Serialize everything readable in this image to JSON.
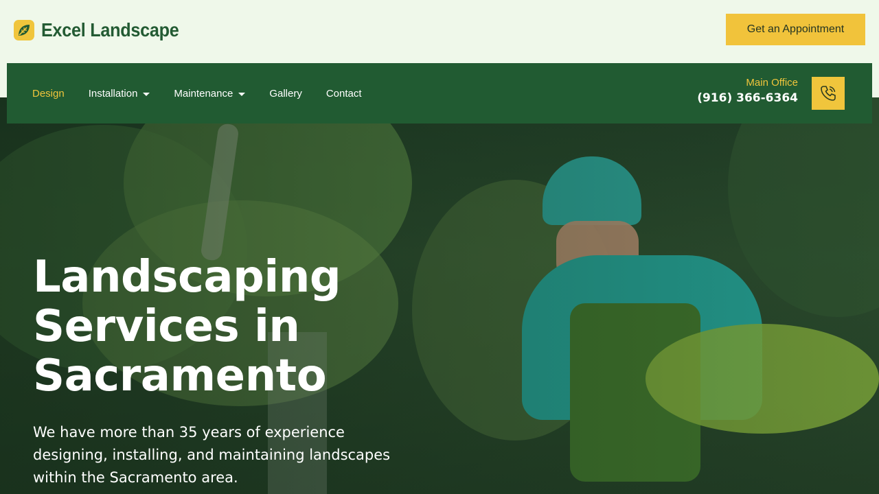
{
  "header": {
    "brand_name": "Excel Landscape",
    "logo_icon": "leaf-icon",
    "cta_label": "Get an Appointment"
  },
  "nav": {
    "items": [
      {
        "label": "Design",
        "active": true,
        "dropdown": false
      },
      {
        "label": "Installation",
        "active": false,
        "dropdown": true
      },
      {
        "label": "Maintenance",
        "active": false,
        "dropdown": true
      },
      {
        "label": "Gallery",
        "active": false,
        "dropdown": false
      },
      {
        "label": "Contact",
        "active": false,
        "dropdown": false
      }
    ],
    "office_label": "Main Office",
    "office_phone": "(916) 366-6364",
    "phone_icon": "phone-icon"
  },
  "hero": {
    "title_lines": [
      "Landscaping",
      "Services in",
      "Sacramento"
    ],
    "subtitle": "We have more than 35 years of experience designing, installing, and maintaining landscapes within the Sacramento area."
  },
  "colors": {
    "brand_green": "#215b32",
    "accent_yellow": "#f0c53c",
    "header_bg": "#eff8ea"
  }
}
